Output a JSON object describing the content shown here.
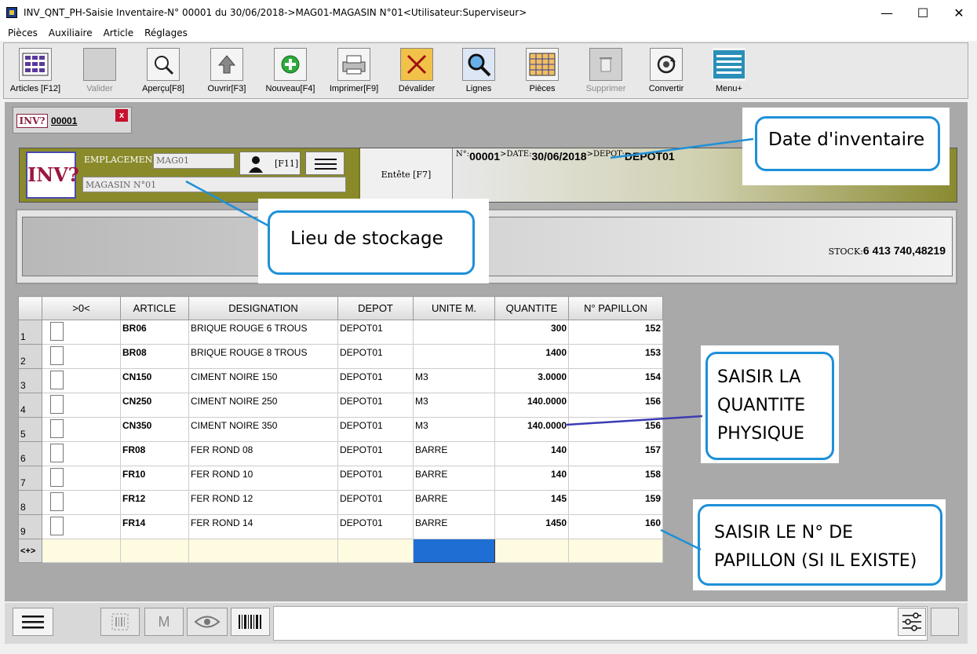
{
  "window": {
    "title": "INV_QNT_PH-Saisie Inventaire-N° 00001 du 30/06/2018->MAG01-MAGASIN N°01<Utilisateur:Superviseur>",
    "minimize": "—",
    "maximize": "☐",
    "close": "✕"
  },
  "menu": [
    "Pièces",
    "Auxiliaire",
    "Article",
    "Réglages"
  ],
  "toolbar": [
    {
      "label": "Articles [F12]",
      "icon": "grid-table-icon",
      "enabled": true
    },
    {
      "label": "Valider",
      "icon": "validate-icon",
      "enabled": false
    },
    {
      "label": "Aperçu[F8]",
      "icon": "preview-magnifier-icon",
      "enabled": true
    },
    {
      "label": "Ouvrir[F3]",
      "icon": "open-arrow-up-icon",
      "enabled": true
    },
    {
      "label": "Nouveau[F4]",
      "icon": "new-plus-icon",
      "enabled": true
    },
    {
      "label": "Imprimer[F9]",
      "icon": "printer-icon",
      "enabled": true
    },
    {
      "label": "Dévalider",
      "icon": "unvalidate-icon",
      "enabled": true
    },
    {
      "label": "Lignes",
      "icon": "search-lines-icon",
      "enabled": true
    },
    {
      "label": "Pièces",
      "icon": "pieces-grid-icon",
      "enabled": true
    },
    {
      "label": "Supprimer",
      "icon": "trash-icon",
      "enabled": false
    },
    {
      "label": "Convertir",
      "icon": "convert-cycle-icon",
      "enabled": true
    },
    {
      "label": "Menu+",
      "icon": "menu-lines-icon",
      "enabled": true
    }
  ],
  "doc_tab": {
    "logo": "INV?",
    "number": "00001",
    "close": "x"
  },
  "header": {
    "logo": "INV?",
    "emplacement_label": "EMPLACEMEN",
    "emplacement_value": "MAG01",
    "magasin_value": "MAGASIN N°01",
    "f11_label": "[F11]",
    "entete_label": "Entête [F7]",
    "num_key": "N°:",
    "num_value": "00001",
    "date_key": ">DATE:",
    "date_value": "30/06/2018",
    "depot_key": ">DEPOT:",
    "depot_value": "DEPOT01"
  },
  "stock": {
    "key": "STOCK:",
    "value": "6 413 740,48219"
  },
  "grid": {
    "columns": [
      ">0<",
      "ARTICLE",
      "DESIGNATION",
      "DEPOT",
      "UNITE M.",
      "QUANTITE",
      "N° PAPILLON"
    ],
    "rows": [
      {
        "n": "1",
        "article": "BR06",
        "designation": "BRIQUE ROUGE 6 TROUS",
        "depot": "DEPOT01",
        "unite": "",
        "quantite": "300",
        "papillon": "152"
      },
      {
        "n": "2",
        "article": "BR08",
        "designation": "BRIQUE ROUGE 8 TROUS",
        "depot": "DEPOT01",
        "unite": "",
        "quantite": "1400",
        "papillon": "153"
      },
      {
        "n": "3",
        "article": "CN150",
        "designation": "CIMENT NOIRE 150",
        "depot": "DEPOT01",
        "unite": "M3",
        "quantite": "3.0000",
        "papillon": "154"
      },
      {
        "n": "4",
        "article": "CN250",
        "designation": "CIMENT NOIRE 250",
        "depot": "DEPOT01",
        "unite": "M3",
        "quantite": "140.0000",
        "papillon": "156"
      },
      {
        "n": "5",
        "article": "CN350",
        "designation": "CIMENT NOIRE 350",
        "depot": "DEPOT01",
        "unite": "M3",
        "quantite": "140.0000",
        "papillon": "156"
      },
      {
        "n": "6",
        "article": "FR08",
        "designation": "FER ROND 08",
        "depot": "DEPOT01",
        "unite": "BARRE",
        "quantite": "140",
        "papillon": "157"
      },
      {
        "n": "7",
        "article": "FR10",
        "designation": "FER ROND 10",
        "depot": "DEPOT01",
        "unite": "BARRE",
        "quantite": "140",
        "papillon": "158"
      },
      {
        "n": "8",
        "article": "FR12",
        "designation": "FER ROND 12",
        "depot": "DEPOT01",
        "unite": "BARRE",
        "quantite": "145",
        "papillon": "159"
      },
      {
        "n": "9",
        "article": "FR14",
        "designation": "FER ROND 14",
        "depot": "DEPOT01",
        "unite": "BARRE",
        "quantite": "1450",
        "papillon": "160"
      }
    ],
    "new_row_marker": "<+>"
  },
  "callouts": {
    "date": "Date d'inventaire",
    "lieu": "Lieu de stockage",
    "quantite": [
      "SAISIR LA",
      "QUANTITE",
      "PHYSIQUE"
    ],
    "papillon": [
      "SAISIR LE N° DE",
      "PAPILLON (SI IL EXISTE)"
    ]
  },
  "bottombar": {
    "m_label": "M"
  },
  "colors": {
    "olive": "#777722",
    "callout_border": "#1e90d8",
    "selection": "#1f6ed4",
    "close_red": "#c8102e"
  }
}
